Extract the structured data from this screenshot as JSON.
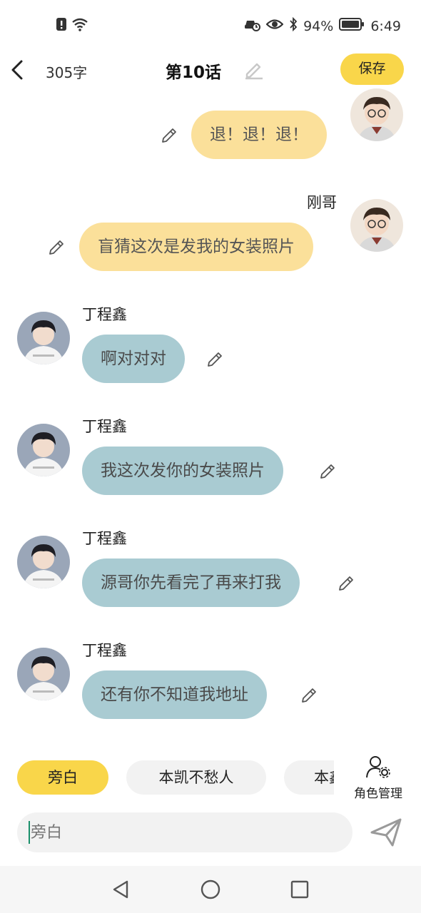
{
  "status_bar": {
    "battery": "94%",
    "time": "6:49",
    "icons": [
      "alert-icon",
      "wifi-icon",
      "car-icon",
      "eye-icon",
      "bluetooth-icon",
      "battery-icon"
    ]
  },
  "header": {
    "word_count": "305字",
    "title": "第10话",
    "save_label": "保存"
  },
  "messages": [
    {
      "side": "right",
      "name": "",
      "text": "退！退！退！"
    },
    {
      "side": "right",
      "name": "刚哥",
      "text": "盲猜这次是发我的女装照片"
    },
    {
      "side": "left",
      "name": "丁程鑫",
      "text": "啊对对对"
    },
    {
      "side": "left",
      "name": "丁程鑫",
      "text": "我这次发你的女装照片"
    },
    {
      "side": "left",
      "name": "丁程鑫",
      "text": "源哥你先看完了再来打我"
    },
    {
      "side": "left",
      "name": "丁程鑫",
      "text": "还有你不知道我地址"
    }
  ],
  "roles": {
    "chips": [
      "旁白",
      "本凯不愁人",
      "本鑫"
    ],
    "manage_label": "角色管理"
  },
  "input": {
    "placeholder": "旁白"
  },
  "colors": {
    "accent_yellow": "#f9d64a",
    "bubble_right": "#fbe09a",
    "bubble_left": "#a9cbd2"
  }
}
